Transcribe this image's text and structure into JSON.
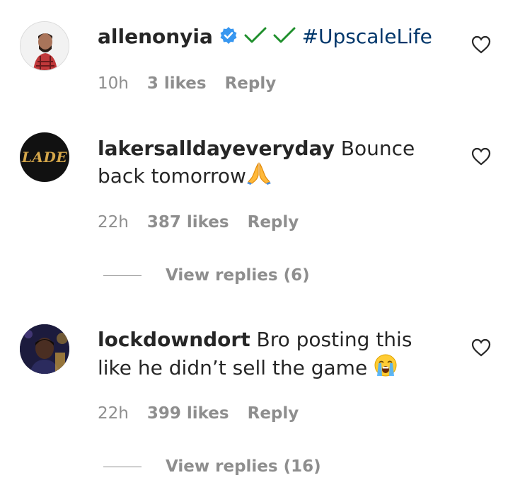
{
  "comments": [
    {
      "username": "allenonyia",
      "verified": true,
      "text_suffix": "#UpscaleLife",
      "time": "10h",
      "likes": "3 likes",
      "reply": "Reply"
    },
    {
      "username": "lakersalldayeveryday",
      "avatar_text": "LADE",
      "text": "Bounce back tomorrow",
      "emoji": "folded-hands",
      "time": "22h",
      "likes": "387 likes",
      "reply": "Reply",
      "view_replies": "View replies (6)"
    },
    {
      "username": "lockdowndort",
      "text": "Bro posting this like he didn’t sell the game",
      "emoji": "loudly-crying-face",
      "time": "22h",
      "likes": "399 likes",
      "reply": "Reply",
      "view_replies": "View replies (16)"
    }
  ],
  "colors": {
    "text": "#262626",
    "meta": "#8e8e8e",
    "hashtag": "#00376b",
    "verified_badge": "#3897f0",
    "checkmark": "#2a9d2f"
  },
  "icons": [
    "heart-outline-icon",
    "verified-badge-icon",
    "checkmark-icon",
    "folded-hands-emoji",
    "loudly-crying-emoji"
  ]
}
